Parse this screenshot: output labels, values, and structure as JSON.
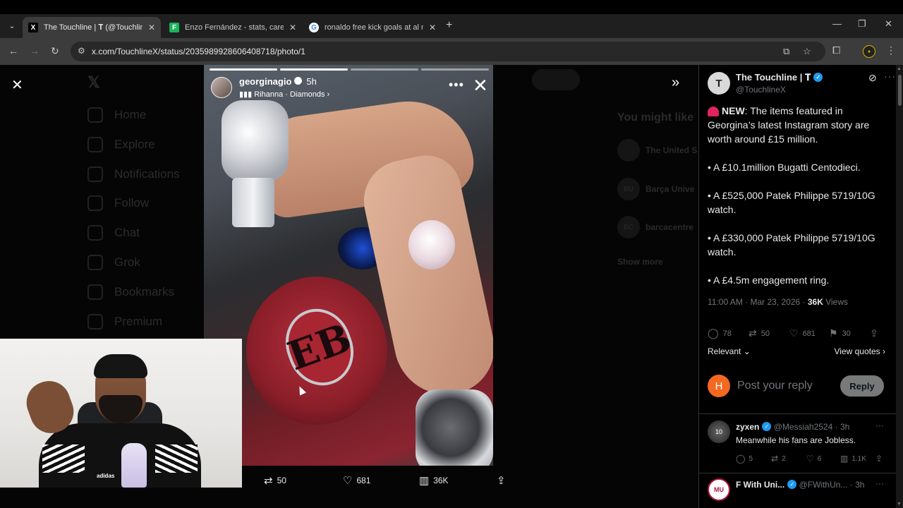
{
  "browser": {
    "tabs": [
      {
        "title": "The Touchline | 𝐓 (@TouchlineX",
        "favicon": "X"
      },
      {
        "title": "Enzo Fernández - stats, career a",
        "favicon": "F"
      },
      {
        "title": "ronaldo free kick goals at al nas",
        "favicon": "G"
      }
    ],
    "url": "x.com/TouchlineX/status/2035989928606408718/photo/1"
  },
  "background": {
    "nav": [
      "Home",
      "Explore",
      "Notifications",
      "Follow",
      "Chat",
      "Grok",
      "Bookmarks",
      "Premium"
    ],
    "follow_label": "Follow",
    "might_like": "You might like",
    "suggestions": [
      {
        "name": "The United S",
        "avatar": ""
      },
      {
        "name": "Barça Unive",
        "avatar": "BU"
      },
      {
        "name": "barcacentre",
        "avatar": "BC"
      }
    ],
    "show_more": "Show more"
  },
  "story": {
    "username": "georginagio",
    "time": "5h",
    "music": "Rihanna · Diamonds",
    "progress_done": 2,
    "progress_total": 4,
    "logo_text": "EB"
  },
  "photo_actions": {
    "retweets": "50",
    "likes": "681",
    "views": "36K"
  },
  "webcam": {
    "shirt_brand": "adidas"
  },
  "tweet": {
    "author_name": "The Touchline | 𝐓",
    "author_handle": "@TouchlineX",
    "avatar_letter": "T",
    "lead_bold": "NEW",
    "lead_text": ": The items featured in Georgina’s latest Instagram story are worth around £15 million.",
    "bullets": [
      "• A £10.1million Bugatti Centodieci.",
      "• A £525,000 Patek Philippe 5719/10G watch.",
      "• A £330,000 Patek Philippe 5719/10G watch.",
      "• A £4.5m engagement ring."
    ],
    "timestamp": "11:00 AM · Mar 23, 2026 · ",
    "views_count": "36K",
    "views_label": "Views",
    "replies": "78",
    "retweets": "50",
    "likes": "681",
    "bookmarks": "30",
    "sort_label": "Relevant",
    "view_quotes": "View quotes"
  },
  "reply_box": {
    "avatar_letter": "H",
    "placeholder": "Post your reply",
    "button": "Reply"
  },
  "replies": [
    {
      "name": "zyxen",
      "handle": "@Messiah2524",
      "time": "· 3h",
      "text": "Meanwhile his fans are Jobless.",
      "replies": "5",
      "retweets": "2",
      "likes": "6",
      "views": "1.1K",
      "avatar": "10"
    },
    {
      "name": "F With Uni...",
      "handle": "@FWithUn...",
      "time": "· 3h",
      "avatar": "MU"
    }
  ],
  "colors": {
    "accent_blue": "#1d9bf0",
    "reply_avatar": "#f4681f",
    "siren": "#e0245e"
  }
}
